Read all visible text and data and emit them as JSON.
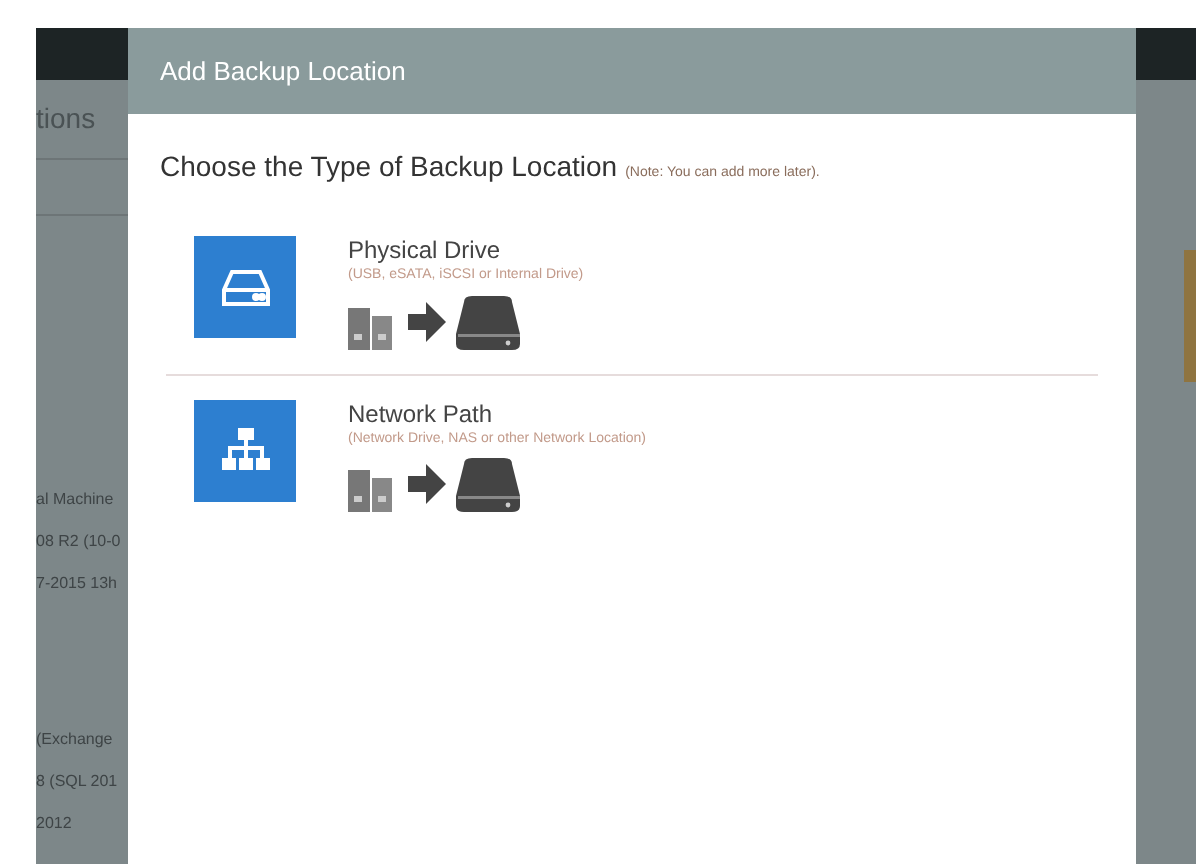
{
  "background": {
    "left_texts": [
      "tions",
      "al Machine",
      "08 R2 (10-0",
      "7-2015 13h",
      "(Exchange",
      "8 (SQL 201",
      "2012"
    ]
  },
  "dialog": {
    "title": "Add Backup Location",
    "heading": "Choose the Type of Backup Location",
    "note": "(Note: You can add more later).",
    "options": [
      {
        "kind": "drive",
        "title": "Physical Drive",
        "subtitle": "(USB, eSATA, iSCSI or Internal Drive)"
      },
      {
        "kind": "network",
        "title": "Network Path",
        "subtitle": "(Network Drive, NAS or other Network Location)"
      }
    ]
  }
}
